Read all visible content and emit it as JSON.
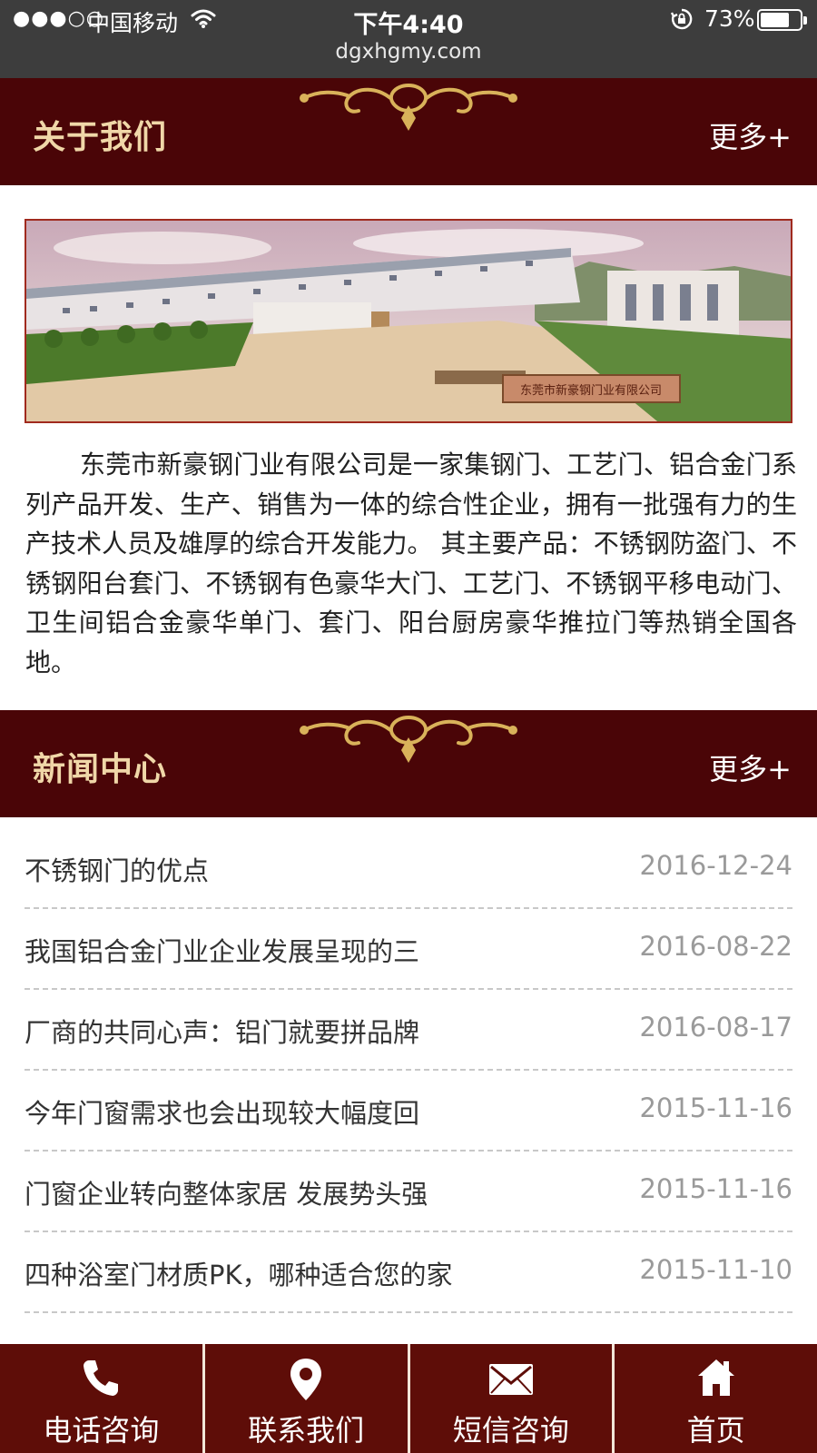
{
  "status_bar": {
    "carrier": "中国移动",
    "time": "下午4:40",
    "battery_percent": "73%",
    "battery_level": 0.73,
    "url": "dgxhgmy.com"
  },
  "about": {
    "title": "关于我们",
    "more": "更多+",
    "photo_sign": "东莞市新豪钢门业有限公司",
    "description": "东莞市新豪钢门业有限公司是一家集钢门、工艺门、铝合金门系列产品开发、生产、销售为一体的综合性企业，拥有一批强有力的生产技术人员及雄厚的综合开发能力。 其主要产品：不锈钢防盗门、不锈钢阳台套门、不锈钢有色豪华大门、工艺门、不锈钢平移电动门、卫生间铝合金豪华单门、套门、阳台厨房豪华推拉门等热销全国各地。"
  },
  "news": {
    "title": "新闻中心",
    "more": "更多+",
    "items": [
      {
        "title": "不锈钢门的优点",
        "date": "2016-12-24"
      },
      {
        "title": "我国铝合金门业企业发展呈现的三",
        "date": "2016-08-22"
      },
      {
        "title": "厂商的共同心声：铝门就要拼品牌",
        "date": "2016-08-17"
      },
      {
        "title": "今年门窗需求也会出现较大幅度回",
        "date": "2015-11-16"
      },
      {
        "title": "门窗企业转向整体家居 发展势头强",
        "date": "2015-11-16"
      },
      {
        "title": "四种浴室门材质PK，哪种适合您的家",
        "date": "2015-11-10"
      }
    ]
  },
  "bottom_nav": [
    {
      "label": "电话咨询",
      "icon": "phone-icon"
    },
    {
      "label": "联系我们",
      "icon": "location-pin-icon"
    },
    {
      "label": "短信咨询",
      "icon": "envelope-icon"
    },
    {
      "label": "首页",
      "icon": "home-icon"
    }
  ],
  "colors": {
    "header_bg": "#4a0507",
    "header_title": "#f0d7a8",
    "nav_bg": "#5e0d08",
    "status_bg": "#3d3d3d"
  }
}
